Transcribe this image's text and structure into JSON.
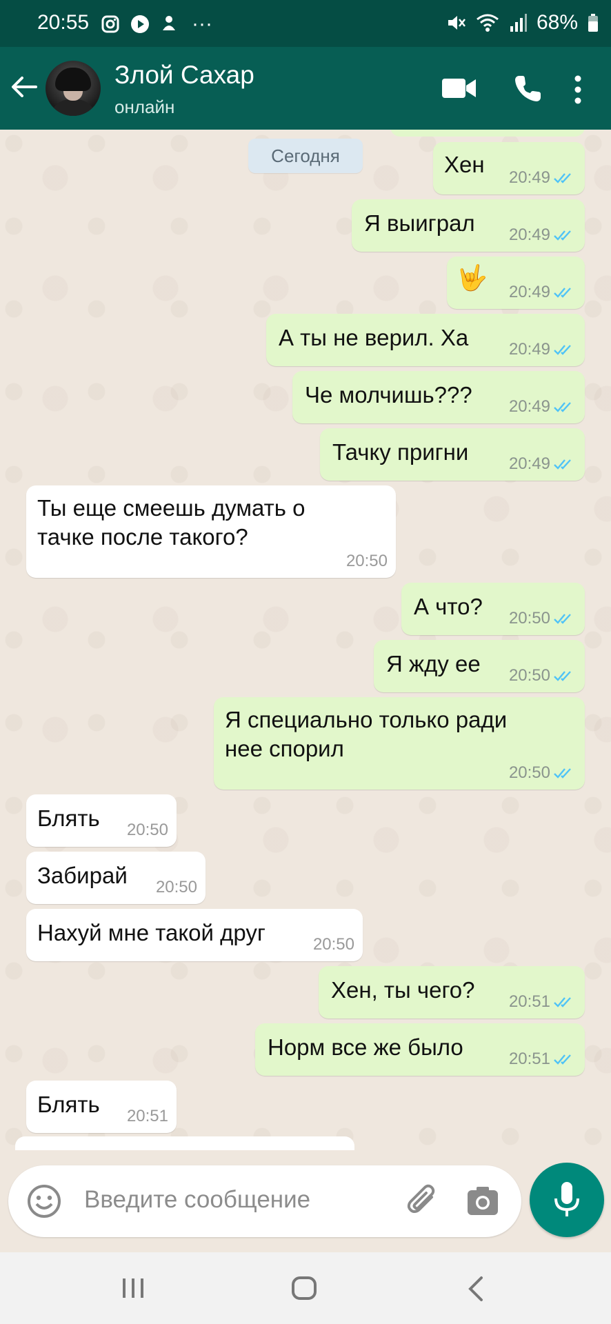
{
  "status_bar": {
    "time": "20:55",
    "dots": "···",
    "battery": "68%"
  },
  "header": {
    "contact_name": "Злой Сахар",
    "contact_status": "онлайн"
  },
  "chat": {
    "day_label": "Сегодня",
    "messages": [
      {
        "dir": "out",
        "text": "Хен",
        "time": "20:49"
      },
      {
        "dir": "out",
        "text": "Я выиграл",
        "time": "20:49"
      },
      {
        "dir": "out",
        "text": "🤟",
        "time": "20:49"
      },
      {
        "dir": "out",
        "text": "А ты не верил. Ха",
        "time": "20:49"
      },
      {
        "dir": "out",
        "text": "Че молчишь???",
        "time": "20:49"
      },
      {
        "dir": "out",
        "text": "Тачку пригни",
        "time": "20:49"
      },
      {
        "dir": "in",
        "text1": "Ты еще смеешь думать о",
        "text2": "тачке после такого?",
        "time": "20:50"
      },
      {
        "dir": "out",
        "text": "А что?",
        "time": "20:50"
      },
      {
        "dir": "out",
        "text": "Я жду ее",
        "time": "20:50"
      },
      {
        "dir": "out",
        "text1": "Я специально только ради",
        "text2": "нее спорил",
        "time": "20:50"
      },
      {
        "dir": "in",
        "text": "Блять",
        "time": "20:50"
      },
      {
        "dir": "in",
        "text": "Забирай",
        "time": "20:50"
      },
      {
        "dir": "in",
        "text": "Нахуй мне такой друг",
        "time": "20:50"
      },
      {
        "dir": "out",
        "text": "Хен, ты чего?",
        "time": "20:51"
      },
      {
        "dir": "out",
        "text": "Норм все же было",
        "time": "20:51"
      },
      {
        "dir": "in",
        "text": "Блять",
        "time": "20:51"
      }
    ]
  },
  "composer": {
    "placeholder": "Введите сообщение"
  },
  "colors": {
    "header": "#075e54",
    "outgoing_bubble": "#e2f7cb",
    "incoming_bubble": "#ffffff",
    "read_ticks": "#4fc3f7",
    "mic_button": "#00897b"
  },
  "icons": [
    "instagram-icon",
    "play-icon",
    "notification-icon",
    "mute-icon",
    "wifi-icon",
    "signal-icon",
    "battery-icon",
    "back-arrow-icon",
    "video-call-icon",
    "phone-icon",
    "more-vert-icon",
    "emoji-icon",
    "attach-icon",
    "camera-icon",
    "mic-icon",
    "recents-icon",
    "home-icon",
    "back-nav-icon"
  ]
}
